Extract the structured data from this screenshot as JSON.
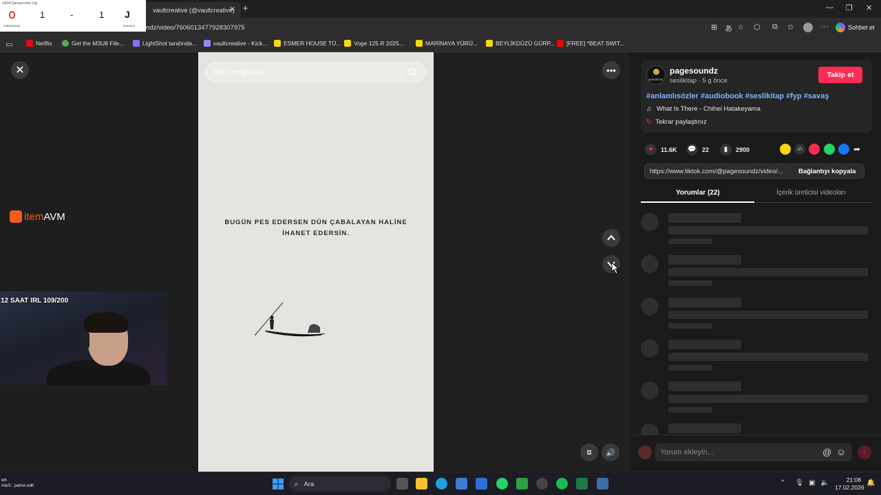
{
  "score": {
    "competition": "UEFA Şampiyonlar Ligi",
    "home_score": "1",
    "separator": "-",
    "away_score": "1",
    "home_team": "Galatasaray",
    "away_team": "Juventus"
  },
  "browser": {
    "tab_title": "vaultcreative (@vaultcreative)",
    "url": "ndz/video/7606013477928307975",
    "copilot_label": "Sohbet et",
    "bookmarks": [
      {
        "label": "Netflix",
        "color": "#e50914"
      },
      {
        "label": "Get the M3U8 File...",
        "color": "#4caf50"
      },
      {
        "label": "LightShot tarafında...",
        "color": "#8a6cff"
      },
      {
        "label": "vaultcreative - Kick...",
        "color": "#8a8aff"
      },
      {
        "label": "ESMER HOUSE TÜ...",
        "color": "#f5d90a"
      },
      {
        "label": "Voge 125 R 2025...",
        "color": "#f5d90a"
      },
      {
        "label": "MARİNAYA YÜRÜ...",
        "color": "#f5d90a"
      },
      {
        "label": "BEYLİKDÜZÜ GÜRP...",
        "color": "#f5d90a"
      },
      {
        "label": "[FREE] *BEAT SWIT...",
        "color": "#ff0000"
      }
    ]
  },
  "stream_overlay": {
    "sponsor_prefix": "item",
    "sponsor_suffix": "AVM",
    "irl_label": "12 SAAT IRL 109/200",
    "chat_line1": "wh",
    "chat_line2": "mer5 : patron edit"
  },
  "video": {
    "search_placeholder": "İlgili içeriği bulun",
    "quote_line1": "BUGÜN PES EDERSEN DÜN ÇABALAYAN HALİNE",
    "quote_line2": "İHANET EDERSİN."
  },
  "post": {
    "username": "pagesoundz",
    "subline": "seslikitap · 5 g önce",
    "avatar_caption": "AUDIOBOOK",
    "follow_label": "Takip et",
    "hashtags": "#anlamlısözler #audiobook #seslikitap #fyp #savaş",
    "music": "What Is There - Chihei Hatakeyama",
    "repost_label": "Tekrar paylaştınız",
    "likes": "11.6K",
    "comments": "22",
    "saves": "2900",
    "link": "https://www.tiktok.com/@pagesoundz/video/...",
    "copy_link_label": "Bağlantıyı kopyala",
    "tab_comments": "Yorumlar (22)",
    "tab_creator": "İçerik üreticisi videoları",
    "comment_placeholder": "Yorum ekleyin..."
  },
  "taskbar": {
    "search_label": "Ara",
    "time": "21:08",
    "date": "17.02.2026"
  },
  "colors": {
    "accent": "#fe2c55",
    "hashtag": "#7fb2ff"
  }
}
